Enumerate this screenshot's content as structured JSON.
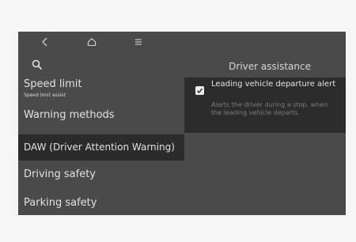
{
  "nav": {
    "back_icon": "back-arrow-icon",
    "home_icon": "home-icon",
    "menu_icon": "menu-icon"
  },
  "search": {
    "icon": "search-icon"
  },
  "menu": {
    "items": [
      {
        "label": "Speed limit",
        "sublabel": "Speed limit assist",
        "selected": false
      },
      {
        "label": "Warning methods",
        "selected": false
      },
      {
        "label": "DAW (Driver Attention Warning)",
        "selected": true
      },
      {
        "label": "Driving safety",
        "selected": false
      },
      {
        "label": "Parking safety",
        "selected": false
      }
    ]
  },
  "panel": {
    "title": "Driver assistance",
    "option": {
      "title": "Leading vehicle departure alert",
      "description": "Alerts the driver during a stop, when the leading vehicle departs.",
      "checked": true
    }
  },
  "colors": {
    "screen_bg": "#4a4a4a",
    "selected_bg": "#2b2b2b",
    "text_primary": "#e2e2e2",
    "text_muted": "#7a7a7a"
  }
}
